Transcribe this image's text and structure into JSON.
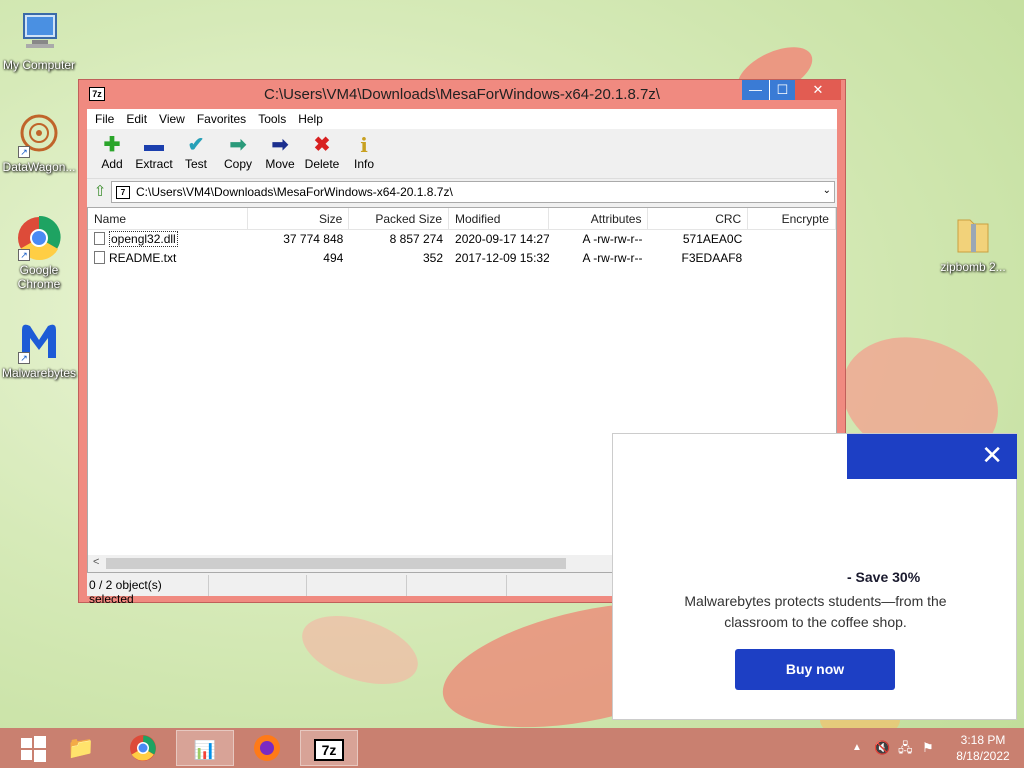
{
  "desktop": {
    "icons": [
      {
        "label": "My Computer"
      },
      {
        "label": "DataWagon..."
      },
      {
        "label": "Google Chrome"
      },
      {
        "label": "Malwarebytes"
      },
      {
        "label": "zipbomb 2..."
      }
    ]
  },
  "window": {
    "title": "C:\\Users\\VM4\\Downloads\\MesaForWindows-x64-20.1.8.7z\\",
    "app_icon_text": "7z",
    "buttons": {
      "minimize": "—",
      "maximize": "☐",
      "close": "✕"
    },
    "menu": [
      "File",
      "Edit",
      "View",
      "Favorites",
      "Tools",
      "Help"
    ],
    "toolbar": [
      {
        "label": "Add",
        "icon": "add-icon",
        "glyph": "✚",
        "color": "#2aa52a"
      },
      {
        "label": "Extract",
        "icon": "extract-icon",
        "glyph": "▬",
        "color": "#1b3fae"
      },
      {
        "label": "Test",
        "icon": "test-icon",
        "glyph": "✔",
        "color": "#27a0b8"
      },
      {
        "label": "Copy",
        "icon": "copy-icon",
        "glyph": "➡",
        "color": "#2a9a7a"
      },
      {
        "label": "Move",
        "icon": "move-icon",
        "glyph": "➡",
        "color": "#1b2f8e"
      },
      {
        "label": "Delete",
        "icon": "delete-icon",
        "glyph": "✖",
        "color": "#d82020"
      },
      {
        "label": "Info",
        "icon": "info-icon",
        "glyph": "i",
        "color": "#c8a020"
      }
    ],
    "address": "C:\\Users\\VM4\\Downloads\\MesaForWindows-x64-20.1.8.7z\\",
    "columns": [
      "Name",
      "Size",
      "Packed Size",
      "Modified",
      "Attributes",
      "CRC",
      "Encrypte"
    ],
    "files": [
      {
        "name": "opengl32.dll",
        "size": "37 774 848",
        "packed": "8 857 274",
        "modified": "2020-09-17 14:27",
        "attributes": "A -rw-rw-r--",
        "crc": "571AEA0C",
        "encrypted": ""
      },
      {
        "name": "README.txt",
        "size": "494",
        "packed": "352",
        "modified": "2017-12-09 15:32",
        "attributes": "A -rw-rw-r--",
        "crc": "F3EDAAF8",
        "encrypted": ""
      }
    ],
    "status": "0 / 2 object(s) selected"
  },
  "ad": {
    "headline": "- Save 30%",
    "body": "Malwarebytes protects students—from the classroom to the coffee shop.",
    "button": "Buy now",
    "accent": "#1d3fc4"
  },
  "taskbar": {
    "clock_time": "3:18 PM",
    "clock_date": "8/18/2022",
    "apps": [
      "Start",
      "File Explorer",
      "Google Chrome",
      "Task Manager",
      "Firefox",
      "7-Zip"
    ]
  }
}
